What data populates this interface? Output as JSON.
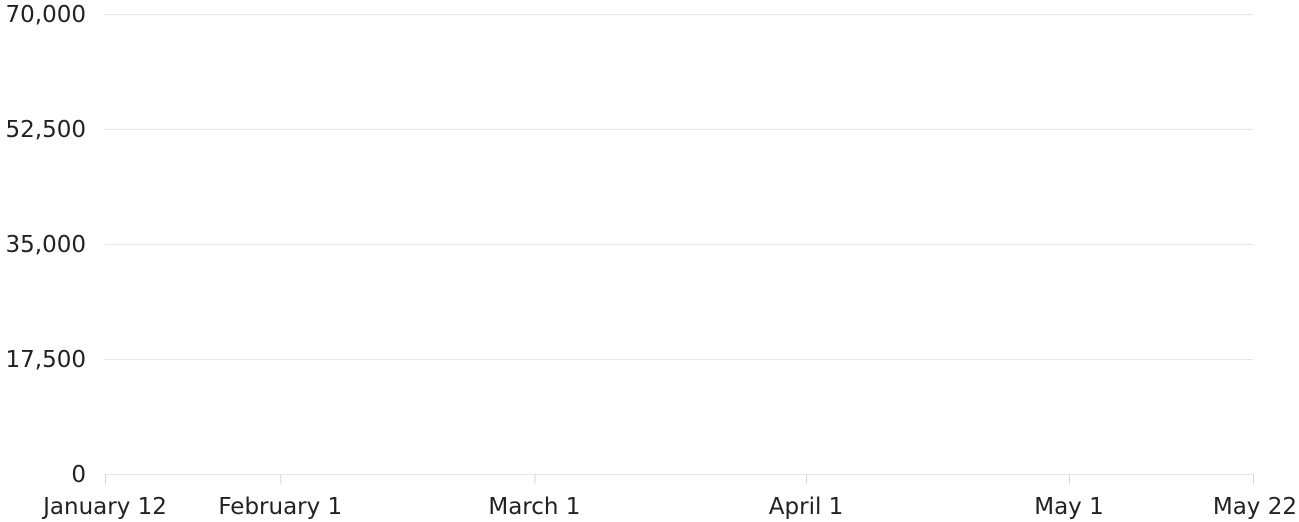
{
  "chart_data": {
    "type": "line",
    "title": "",
    "xlabel": "",
    "ylabel": "",
    "x_axis": {
      "type": "date",
      "range": [
        "January 12",
        "May 22"
      ],
      "ticks": [
        {
          "label": "January 12",
          "date": "01-12"
        },
        {
          "label": "February 1",
          "date": "02-01"
        },
        {
          "label": "March 1",
          "date": "03-01"
        },
        {
          "label": "April 1",
          "date": "04-01"
        },
        {
          "label": "May 1",
          "date": "05-01"
        },
        {
          "label": "May 22",
          "date": "05-22"
        }
      ]
    },
    "y_axis": {
      "range": [
        0,
        70000
      ],
      "ticks": [
        {
          "label": "0",
          "value": 0
        },
        {
          "label": "17,500",
          "value": 17500
        },
        {
          "label": "35,000",
          "value": 35000
        },
        {
          "label": "52,500",
          "value": 52500
        },
        {
          "label": "70,000",
          "value": 70000
        }
      ]
    },
    "grid": true,
    "series": []
  },
  "colors": {
    "gridline": "#e6e6e6",
    "tick": "#d6d6d6",
    "text": "#222222"
  }
}
